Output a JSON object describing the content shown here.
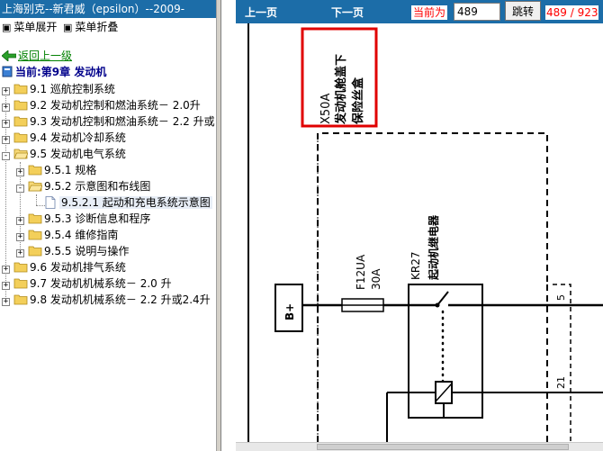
{
  "left_pane": {
    "title": "上海别克--新君威（epsilon）--2009-",
    "expand_label": "菜单展开",
    "collapse_label": "菜单折叠",
    "back_label": "返回上一级",
    "current_label": "当前:第9章  发动机",
    "tree": [
      {
        "label": "9.1 巡航控制系统",
        "expander": "+"
      },
      {
        "label": "9.2 发动机控制和燃油系统－ 2.0升",
        "expander": "+"
      },
      {
        "label": "9.3 发动机控制和燃油系统－ 2.2 升或",
        "expander": "+"
      },
      {
        "label": "9.4 发动机冷却系统",
        "expander": "+"
      },
      {
        "label": "9.5 发动机电气系统",
        "expander": "-"
      },
      {
        "label": "9.5.1 规格",
        "expander": "+"
      },
      {
        "label": "9.5.2 示意图和布线图",
        "expander": "-"
      },
      {
        "label": "9.5.2.1 起动和充电系统示意图",
        "expander": ""
      },
      {
        "label": "9.5.3 诊断信息和程序",
        "expander": "+"
      },
      {
        "label": "9.5.4 维修指南",
        "expander": "+"
      },
      {
        "label": "9.5.5 说明与操作",
        "expander": "+"
      },
      {
        "label": "9.6 发动机排气系统",
        "expander": "+"
      },
      {
        "label": "9.7 发动机机械系统－ 2.0 升",
        "expander": "+"
      },
      {
        "label": "9.8 发动机机械系统－ 2.2 升或2.4升",
        "expander": "+"
      }
    ]
  },
  "toolbar": {
    "prev_label": "上一页",
    "next_label": "下一页",
    "current_page_label": "当前为",
    "page_value": "489",
    "jump_label": "跳转",
    "page_total": "489 / 923"
  },
  "diagram": {
    "connector_label": "X50A",
    "fuse_box_label_1": "发动机舱盖下",
    "fuse_box_label_2": "保险丝盒",
    "fuse_name": "F12UA",
    "fuse_rating": "30A",
    "relay_name": "KR27",
    "relay_desc": "起动机继电器",
    "battery_label": "B+",
    "pin_5": "5",
    "pin_21": "21"
  },
  "colors": {
    "header_blue": "#1c6da8",
    "highlight_red": "#ff0000",
    "link_green": "#008000"
  }
}
